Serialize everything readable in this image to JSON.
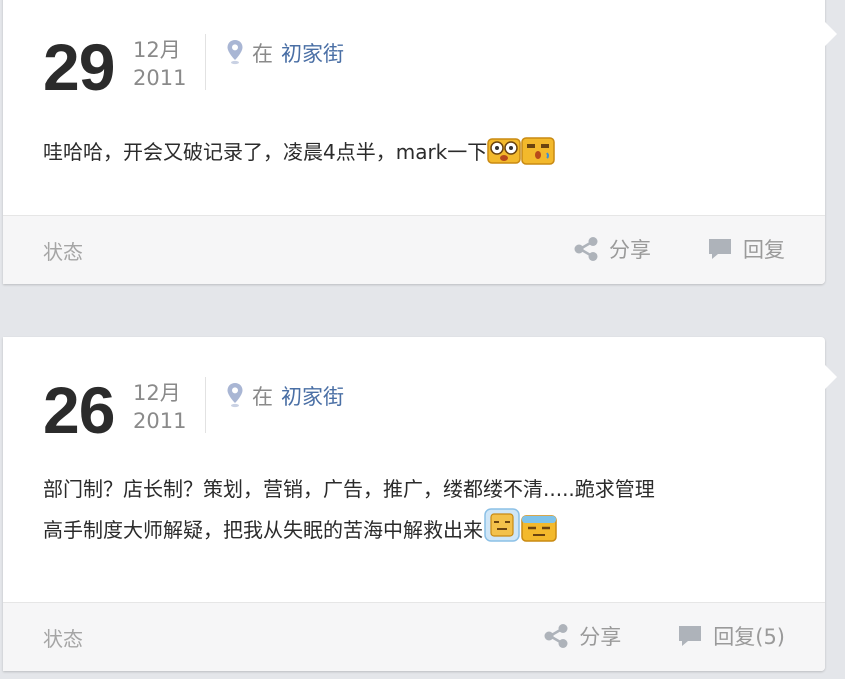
{
  "posts": [
    {
      "day": "29",
      "month": "12月",
      "year": "2011",
      "location_prefix": "在",
      "location": "初家街",
      "text_lines": [
        "哇哈哈，开会又破记录了，凌晨4点半，mark一下"
      ],
      "emoticons": [
        "shocked-face-emoticon",
        "surprised-face-emoticon"
      ],
      "type_label": "状态",
      "share_label": "分享",
      "reply_label": "回复"
    },
    {
      "day": "26",
      "month": "12月",
      "year": "2011",
      "location_prefix": "在",
      "location": "初家街",
      "text_lines": [
        "部门制？店长制？策划，营销，广告，推广，缕都缕不清.....跪求管理",
        "高手制度大师解疑，把我从失眠的苦海中解救出来"
      ],
      "emoticons": [
        "sleepy-face-emoticon",
        "tired-face-emoticon"
      ],
      "type_label": "状态",
      "share_label": "分享",
      "reply_label": "回复(5)"
    }
  ],
  "colors": {
    "background": "#e4e6ea",
    "card": "#ffffff",
    "location_link": "#4a6fa5",
    "muted": "#9a9a9a"
  },
  "icons": [
    "location-pin-icon",
    "share-icon",
    "comment-icon"
  ]
}
